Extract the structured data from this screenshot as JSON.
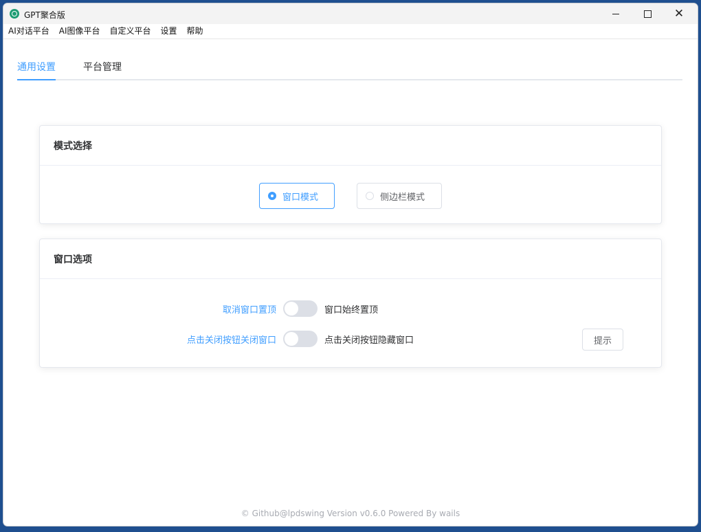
{
  "window": {
    "title": "GPT聚合版",
    "controls": {
      "minimize": "minimize-icon",
      "maximize": "maximize-icon",
      "close": "close-icon"
    }
  },
  "menu": [
    "AI对话平台",
    "AI图像平台",
    "自定义平台",
    "设置",
    "帮助"
  ],
  "tabs": [
    {
      "label": "通用设置",
      "active": true
    },
    {
      "label": "平台管理",
      "active": false
    }
  ],
  "mode_card": {
    "title": "模式选择",
    "options": [
      {
        "label": "窗口模式",
        "checked": true
      },
      {
        "label": "侧边栏模式",
        "checked": false
      }
    ]
  },
  "window_card": {
    "title": "窗口选项",
    "options": [
      {
        "inactive_text": "取消窗口置顶",
        "active_text": "窗口始终置顶",
        "on": false
      },
      {
        "inactive_text": "点击关闭按钮关闭窗口",
        "active_text": "点击关闭按钮隐藏窗口",
        "on": false
      }
    ],
    "tip_button": "提示"
  },
  "footer": "© Github@lpdswing Version v0.6.0 Powered By wails",
  "colors": {
    "accent": "#409eff",
    "text": "#303133",
    "border": "#dcdfe6"
  }
}
